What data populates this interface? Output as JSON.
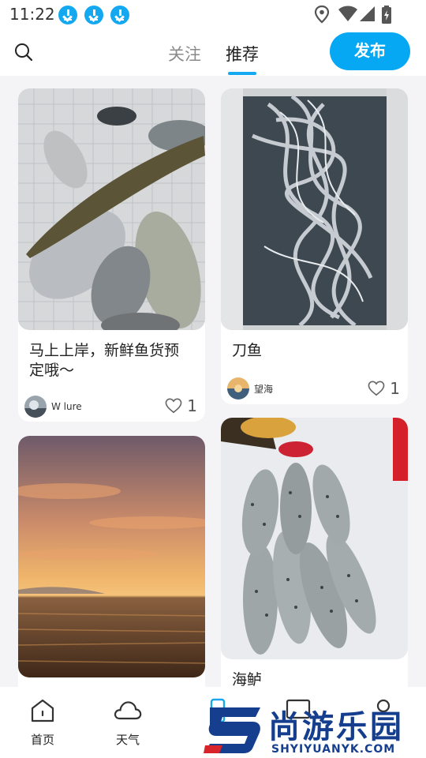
{
  "status_bar": {
    "time": "11:22",
    "icons": [
      "download-icon",
      "download-icon",
      "download-icon",
      "location-icon",
      "wifi-icon",
      "signal-icon",
      "battery-charging-icon"
    ]
  },
  "header": {
    "search_icon": "search-icon",
    "tabs": [
      {
        "label": "关注",
        "active": false
      },
      {
        "label": "推荐",
        "active": true
      }
    ],
    "publish_label": "发布",
    "accent_color": "#07a8f3"
  },
  "feed": {
    "cards": [
      {
        "title": "马上上岸，新鲜鱼货预定哦～",
        "author": "W lure",
        "likes": "1",
        "image": "photo of assorted fresh fish on a net"
      },
      {
        "title": "刀鱼",
        "author": "望海",
        "likes": "1",
        "image": "photo of hairtail fish in a cooler"
      },
      {
        "title": "",
        "author": "",
        "likes": "",
        "image": "photo of sunset over the sea"
      },
      {
        "title": "海鲈",
        "author": "",
        "likes": "",
        "image": "photo of spotted sea bass in a cooler"
      }
    ]
  },
  "bottom_nav": {
    "items": [
      {
        "label": "首页",
        "icon": "home-icon"
      },
      {
        "label": "天气",
        "icon": "cloud-icon"
      },
      {
        "label": "",
        "icon": "fish-icon"
      },
      {
        "label": "",
        "icon": "message-icon"
      },
      {
        "label": "",
        "icon": "profile-icon"
      }
    ]
  },
  "watermark": {
    "text": "尚游乐园",
    "url": "SHYIYUANYK.COM"
  }
}
